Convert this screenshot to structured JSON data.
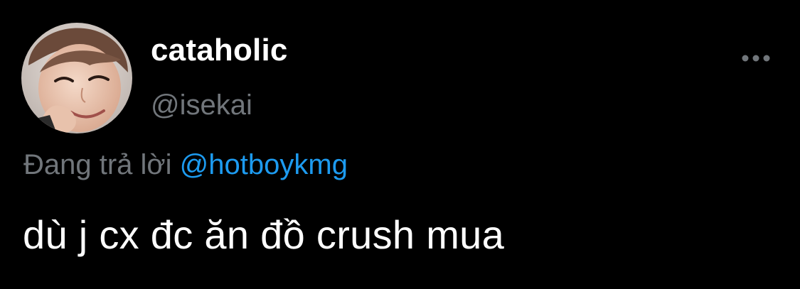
{
  "tweet": {
    "author": {
      "display_name": "cataholic",
      "handle": "@isekai",
      "avatar": "profile-photo"
    },
    "more_icon": "more-horizontal-icon",
    "reply": {
      "prefix": "Đang trả lời",
      "mention": "@hotboykmg"
    },
    "text": "dù j cx đc ăn đồ crush mua"
  },
  "colors": {
    "background": "#000000",
    "primary_text": "#ffffff",
    "secondary_text": "#71767b",
    "link": "#1d9bf0"
  }
}
